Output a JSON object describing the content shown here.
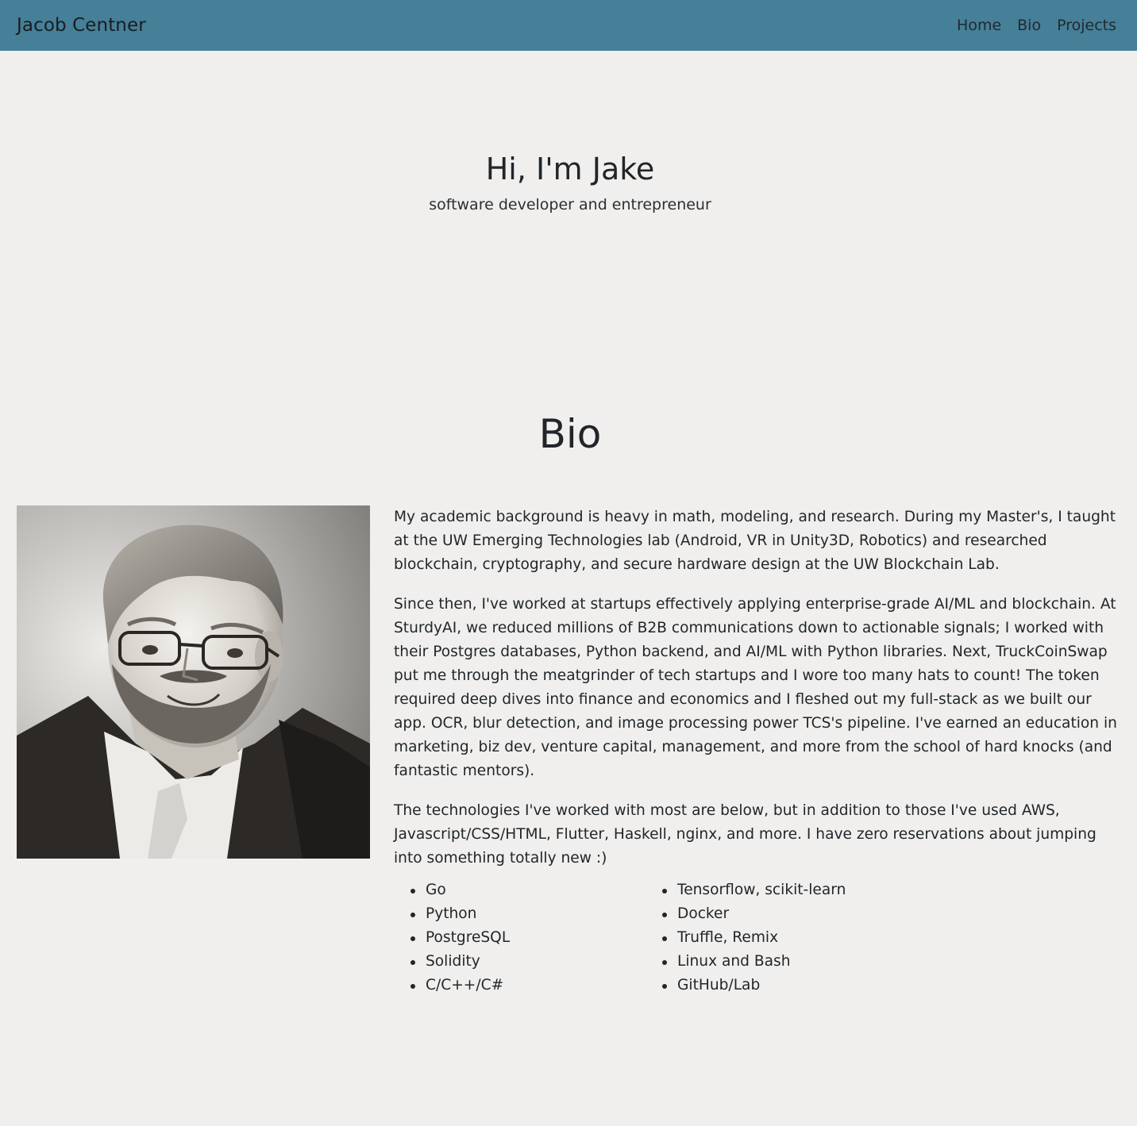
{
  "navbar": {
    "brand": "Jacob Centner",
    "links": [
      "Home",
      "Bio",
      "Projects"
    ],
    "background": "#457f98"
  },
  "hero": {
    "title": "Hi, I'm Jake",
    "subtitle": "software developer and entrepreneur"
  },
  "bio": {
    "heading": "Bio",
    "paragraphs": [
      "My academic background is heavy in math, modeling, and research. During my Master's, I taught at the UW Emerging Technologies lab (Android, VR in Unity3D, Robotics) and researched blockchain, cryptography, and secure hardware design at the UW Blockchain Lab.",
      "Since then, I've worked at startups effectively applying enterprise-grade AI/ML and blockchain. At SturdyAI, we reduced millions of B2B communications down to actionable signals; I worked with their Postgres databases, Python backend, and AI/ML with Python libraries. Next, TruckCoinSwap put me through the meatgrinder of tech startups and I wore too many hats to count! The token required deep dives into finance and economics and I fleshed out my full-stack as we built our app. OCR, blur detection, and image processing power TCS's pipeline. I've earned an education in marketing, biz dev, venture capital, management, and more from the school of hard knocks (and fantastic mentors).",
      "The technologies I've worked with most are below, but in addition to those I've used AWS, Javascript/CSS/HTML, Flutter, Haskell, nginx, and more. I have zero reservations about jumping into something totally new :)"
    ],
    "tech_column_1": [
      "Go",
      "Python",
      "PostgreSQL",
      "Solidity",
      "C/C++/C#"
    ],
    "tech_column_2": [
      "Tensorflow, scikit-learn",
      "Docker",
      "Truffle, Remix",
      "Linux and Bash",
      "GitHub/Lab"
    ]
  },
  "colors": {
    "page_background": "#f0efee",
    "navbar": "#457f98",
    "text": "#212529"
  }
}
